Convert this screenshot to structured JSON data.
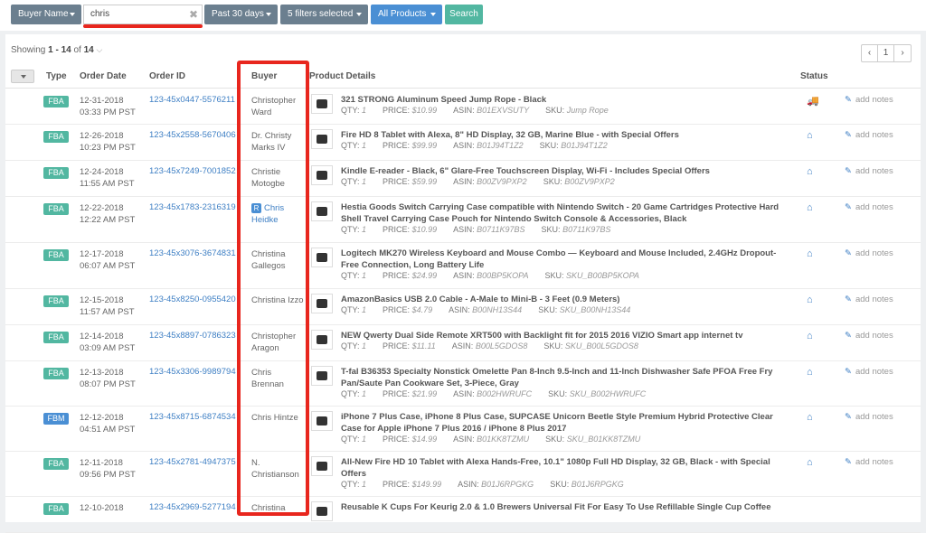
{
  "filters": {
    "field": "Buyer Name",
    "query": "chris",
    "range": "Past 30 days",
    "filters": "5 filters selected",
    "products": "All Products",
    "search": "Search"
  },
  "summary": {
    "prefix": "Showing",
    "range": "1 - 14",
    "of": "of",
    "total": "14"
  },
  "pager": {
    "prev": "‹",
    "page": "1",
    "next": "›"
  },
  "columns": {
    "type": "Type",
    "order_date": "Order Date",
    "order_id": "Order ID",
    "buyer": "Buyer",
    "product": "Product Details",
    "status": "Status"
  },
  "labels": {
    "qty": "QTY:",
    "price": "PRICE:",
    "asin": "ASIN:",
    "sku": "SKU:",
    "add_notes": "add notes"
  },
  "colors": {
    "fba": "#52b7a1",
    "fbm": "#4a8fd4",
    "highlight": "#e8261e",
    "link": "#3e7fc4"
  },
  "rows": [
    {
      "type": "FBA",
      "date": "12-31-2018",
      "time": "03:33 PM PST",
      "order_id": "123-45x0447-5576211",
      "buyer": "Christopher Ward",
      "title": "321 STRONG Aluminum Speed Jump Rope - Black",
      "qty": "1",
      "price": "$10.99",
      "asin": "B01EXVSUTY",
      "sku": "Jump Rope",
      "status_icon": "truck-icon"
    },
    {
      "type": "FBA",
      "date": "12-26-2018",
      "time": "10:23 PM PST",
      "order_id": "123-45x2558-5670406",
      "buyer": "Dr. Christy Marks IV",
      "title": "Fire HD 8 Tablet with Alexa, 8\" HD Display, 32 GB, Marine Blue - with Special Offers",
      "qty": "1",
      "price": "$99.99",
      "asin": "B01J94T1Z2",
      "sku": "B01J94T1Z2",
      "status_icon": "home-icon"
    },
    {
      "type": "FBA",
      "date": "12-24-2018",
      "time": "11:55 AM PST",
      "order_id": "123-45x7249-7001852",
      "buyer": "Christie Motogbe",
      "title": "Kindle E-reader - Black, 6\" Glare-Free Touchscreen Display, Wi-Fi - Includes Special Offers",
      "qty": "1",
      "price": "$59.99",
      "asin": "B00ZV9PXP2",
      "sku": "B00ZV9PXP2",
      "status_icon": "home-icon"
    },
    {
      "type": "FBA",
      "date": "12-22-2018",
      "time": "12:22 AM PST",
      "order_id": "123-45x1783-2316319",
      "buyer": "Chris Heidke",
      "buyer_badge": "R",
      "title": "Hestia Goods Switch Carrying Case compatible with Nintendo Switch - 20 Game Cartridges Protective Hard Shell Travel Carrying Case Pouch for Nintendo Switch Console & Accessories, Black",
      "qty": "1",
      "price": "$10.99",
      "asin": "B0711K97BS",
      "sku": "B0711K97BS",
      "status_icon": "home-icon"
    },
    {
      "type": "FBA",
      "date": "12-17-2018",
      "time": "06:07 AM PST",
      "order_id": "123-45x3076-3674831",
      "buyer": "Christina Gallegos",
      "title": "Logitech MK270 Wireless Keyboard and Mouse Combo — Keyboard and Mouse Included, 2.4GHz Dropout-Free Connection, Long Battery Life",
      "qty": "1",
      "price": "$24.99",
      "asin": "B00BP5KOPA",
      "sku": "SKU_B00BP5KOPA",
      "status_icon": "home-icon"
    },
    {
      "type": "FBA",
      "date": "12-15-2018",
      "time": "11:57 AM PST",
      "order_id": "123-45x8250-0955420",
      "buyer": "Christina Izzo",
      "title": "AmazonBasics USB 2.0 Cable - A-Male to Mini-B - 3 Feet (0.9 Meters)",
      "qty": "1",
      "price": "$4.79",
      "asin": "B00NH13S44",
      "sku": "SKU_B00NH13S44",
      "status_icon": "home-icon"
    },
    {
      "type": "FBA",
      "date": "12-14-2018",
      "time": "03:09 AM PST",
      "order_id": "123-45x8897-0786323",
      "buyer": "Christopher Aragon",
      "title": "NEW Qwerty Dual Side Remote XRT500 with Backlight fit for 2015 2016 VIZIO Smart app internet tv",
      "qty": "1",
      "price": "$11.11",
      "asin": "B00L5GDOS8",
      "sku": "SKU_B00L5GDOS8",
      "status_icon": "home-icon"
    },
    {
      "type": "FBA",
      "date": "12-13-2018",
      "time": "08:07 PM PST",
      "order_id": "123-45x3306-9989794",
      "buyer": "Chris Brennan",
      "title": "T-fal B36353 Specialty Nonstick Omelette Pan 8-Inch 9.5-Inch and 11-Inch Dishwasher Safe PFOA Free Fry Pan/Saute Pan Cookware Set, 3-Piece, Gray",
      "qty": "1",
      "price": "$21.99",
      "asin": "B002HWRUFC",
      "sku": "SKU_B002HWRUFC",
      "status_icon": "home-icon"
    },
    {
      "type": "FBM",
      "date": "12-12-2018",
      "time": "04:51 AM PST",
      "order_id": "123-45x8715-6874534",
      "buyer": "Chris Hintze",
      "title": "iPhone 7 Plus Case, iPhone 8 Plus Case, SUPCASE Unicorn Beetle Style Premium Hybrid Protective Clear Case for Apple iPhone 7 Plus 2016 / iPhone 8 Plus 2017",
      "qty": "1",
      "price": "$14.99",
      "asin": "B01KK8TZMU",
      "sku": "SKU_B01KK8TZMU",
      "status_icon": "home-icon"
    },
    {
      "type": "FBA",
      "date": "12-11-2018",
      "time": "09:56 PM PST",
      "order_id": "123-45x2781-4947375",
      "buyer": "N. Christianson",
      "title": "All-New Fire HD 10 Tablet with Alexa Hands-Free, 10.1\" 1080p Full HD Display, 32 GB, Black - with Special Offers",
      "qty": "1",
      "price": "$149.99",
      "asin": "B01J6RPGKG",
      "sku": "B01J6RPGKG",
      "status_icon": "home-icon"
    },
    {
      "type": "FBA",
      "date": "12-10-2018",
      "time": "",
      "order_id": "123-45x2969-5277194",
      "buyer": "Christina",
      "title": "Reusable K Cups For Keurig 2.0 & 1.0 Brewers Universal Fit For Easy To Use Refillable Single Cup Coffee",
      "qty": "",
      "price": "",
      "asin": "",
      "sku": "",
      "status_icon": ""
    }
  ]
}
